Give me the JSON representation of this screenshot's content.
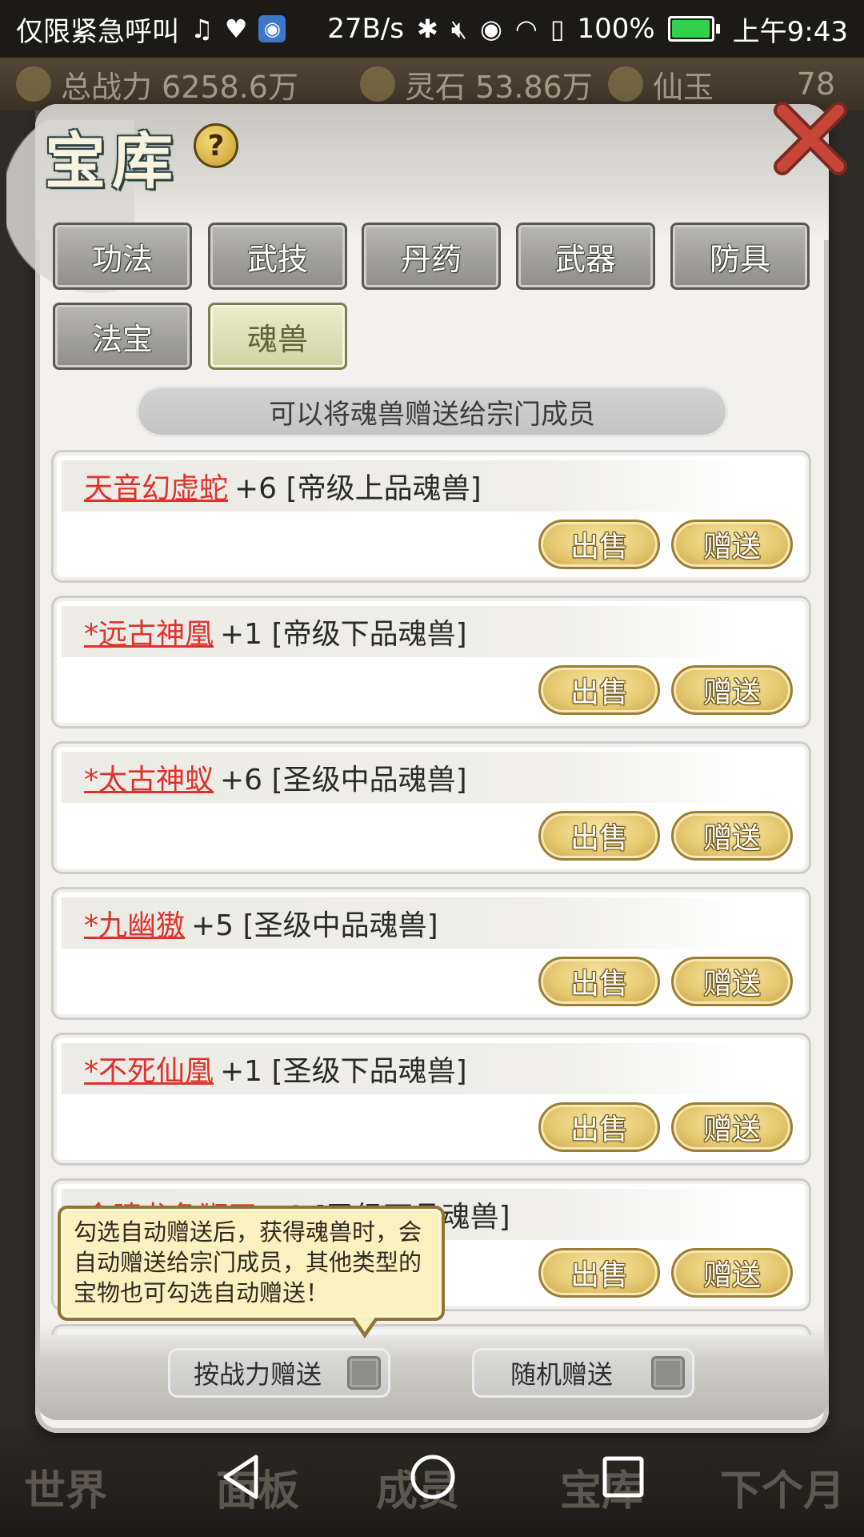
{
  "status_bar": {
    "carrier_text": "仅限紧急呼叫",
    "net_speed": "27B/s",
    "battery_percent": "100%",
    "battery_level": 1.0,
    "time": "上午9:43"
  },
  "game_topbar": {
    "power_label": "总战力",
    "power_value": "6258.6万",
    "stone_label": "灵石",
    "stone_value": "53.86万",
    "jade_label": "仙玉",
    "jade_value": "78"
  },
  "bottom_nav": {
    "items": [
      "世界",
      "面板",
      "成员",
      "宝库",
      "下个月"
    ]
  },
  "dialog": {
    "title": "宝库",
    "help_symbol": "?",
    "tabs": [
      {
        "label": "功法",
        "active": false
      },
      {
        "label": "武技",
        "active": false
      },
      {
        "label": "丹药",
        "active": false
      },
      {
        "label": "武器",
        "active": false
      },
      {
        "label": "防具",
        "active": false
      },
      {
        "label": "法宝",
        "active": false
      },
      {
        "label": "魂兽",
        "active": true
      }
    ],
    "banner_text": "可以将魂兽赠送给宗门成员",
    "items": [
      {
        "name": "天音幻虚蛇",
        "extra": "+6 [帝级上品魂兽]",
        "sell": "出售",
        "gift": "赠送"
      },
      {
        "name": "*远古神凰",
        "extra": "+1 [帝级下品魂兽]",
        "sell": "出售",
        "gift": "赠送"
      },
      {
        "name": "*太古神蚁",
        "extra": "+6 [圣级中品魂兽]",
        "sell": "出售",
        "gift": "赠送"
      },
      {
        "name": "*九幽獓",
        "extra": "+5 [圣级中品魂兽]",
        "sell": "出售",
        "gift": "赠送"
      },
      {
        "name": "*不死仙凰",
        "extra": "+1 [圣级下品魂兽]",
        "sell": "出售",
        "gift": "赠送"
      },
      {
        "name": "金睛龙角狮王",
        "extra": "+3 [圣级下品魂兽]",
        "sell": "出售",
        "gift": "赠送"
      }
    ],
    "tooltip_text": "勾选自动赠送后，获得魂兽时，会自动赠送给宗门成员，其他类型的宝物也可勾选自动赠送！",
    "toggle_power": {
      "label": "按战力赠送",
      "checked": false
    },
    "toggle_random": {
      "label": "随机赠送",
      "checked": false
    }
  },
  "colors": {
    "item_name": "#e0322c",
    "gold_button": "#e7cb74",
    "active_tab": "#cfd4a6",
    "tooltip_bg": "#fbf0c0"
  }
}
